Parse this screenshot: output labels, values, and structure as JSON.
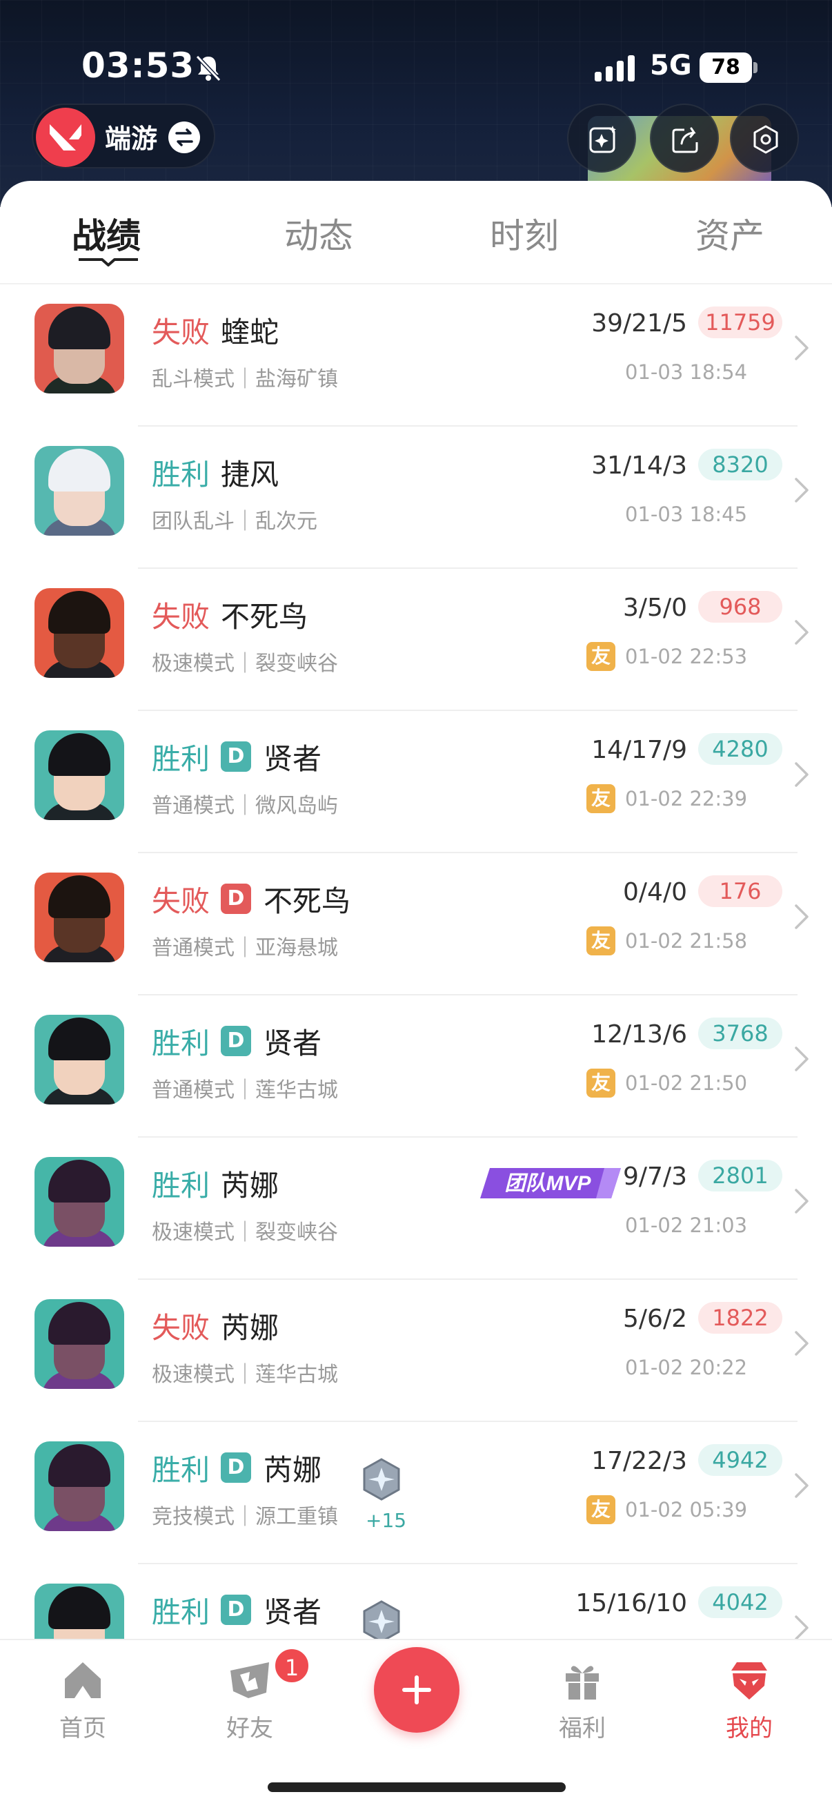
{
  "status_bar": {
    "time": "03:53",
    "network": "5G",
    "battery": "78"
  },
  "header": {
    "game_name": "端游"
  },
  "tabs": [
    {
      "label": "战绩",
      "active": true
    },
    {
      "label": "动态",
      "active": false
    },
    {
      "label": "时刻",
      "active": false
    },
    {
      "label": "资产",
      "active": false
    }
  ],
  "matches": [
    {
      "result": "失败",
      "outcome": "loss",
      "duo": false,
      "hero": "蝰蛇",
      "mode": "乱斗模式｜盐海矿镇",
      "kda": "39/21/5",
      "score": "11759",
      "datetime": "01-03 18:54",
      "friend": false,
      "mvp": false,
      "rank": false
    },
    {
      "result": "胜利",
      "outcome": "win",
      "duo": false,
      "hero": "捷风",
      "mode": "团队乱斗｜乱次元",
      "kda": "31/14/3",
      "score": "8320",
      "datetime": "01-03 18:45",
      "friend": false,
      "mvp": false,
      "rank": false
    },
    {
      "result": "失败",
      "outcome": "loss",
      "duo": false,
      "hero": "不死鸟",
      "mode": "极速模式｜裂变峡谷",
      "kda": "3/5/0",
      "score": "968",
      "datetime": "01-02 22:53",
      "friend": true,
      "mvp": false,
      "rank": false
    },
    {
      "result": "胜利",
      "outcome": "win",
      "duo": true,
      "hero": "贤者",
      "mode": "普通模式｜微风岛屿",
      "kda": "14/17/9",
      "score": "4280",
      "datetime": "01-02 22:39",
      "friend": true,
      "mvp": false,
      "rank": false
    },
    {
      "result": "失败",
      "outcome": "loss",
      "duo": true,
      "hero": "不死鸟",
      "mode": "普通模式｜亚海悬城",
      "kda": "0/4/0",
      "score": "176",
      "datetime": "01-02 21:58",
      "friend": true,
      "mvp": false,
      "rank": false
    },
    {
      "result": "胜利",
      "outcome": "win",
      "duo": true,
      "hero": "贤者",
      "mode": "普通模式｜莲华古城",
      "kda": "12/13/6",
      "score": "3768",
      "datetime": "01-02 21:50",
      "friend": true,
      "mvp": false,
      "rank": false
    },
    {
      "result": "胜利",
      "outcome": "win",
      "duo": false,
      "hero": "芮娜",
      "mode": "极速模式｜裂变峡谷",
      "kda": "9/7/3",
      "score": "2801",
      "datetime": "01-02 21:03",
      "friend": false,
      "mvp": true,
      "rank": false
    },
    {
      "result": "失败",
      "outcome": "loss",
      "duo": false,
      "hero": "芮娜",
      "mode": "极速模式｜莲华古城",
      "kda": "5/6/2",
      "score": "1822",
      "datetime": "01-02 20:22",
      "friend": false,
      "mvp": false,
      "rank": false
    },
    {
      "result": "胜利",
      "outcome": "win",
      "duo": true,
      "hero": "芮娜",
      "mode": "竞技模式｜源工重镇",
      "kda": "17/22/3",
      "score": "4942",
      "datetime": "01-02 05:39",
      "friend": true,
      "mvp": false,
      "rank": true,
      "rank_delta": "+15"
    },
    {
      "result": "胜利",
      "outcome": "win",
      "duo": true,
      "hero": "贤者",
      "mode": "",
      "kda": "15/16/10",
      "score": "4042",
      "datetime": "",
      "friend": false,
      "mvp": false,
      "rank": true
    }
  ],
  "labels": {
    "duo_badge": "D",
    "friend_badge": "友",
    "mvp": "团队MVP"
  },
  "bottom_nav": [
    {
      "label": "首页",
      "icon": "home-icon",
      "active": false
    },
    {
      "label": "好友",
      "icon": "friends-icon",
      "active": false,
      "badge": "1"
    },
    {
      "label": "福利",
      "icon": "gift-icon",
      "active": false
    },
    {
      "label": "我的",
      "icon": "profile-icon",
      "active": true
    }
  ],
  "colors": {
    "win": "#3aada8",
    "loss": "#e35a5a",
    "accent": "#ef4a55",
    "friend": "#f0b24a",
    "mvp": "#8a4fe0"
  }
}
